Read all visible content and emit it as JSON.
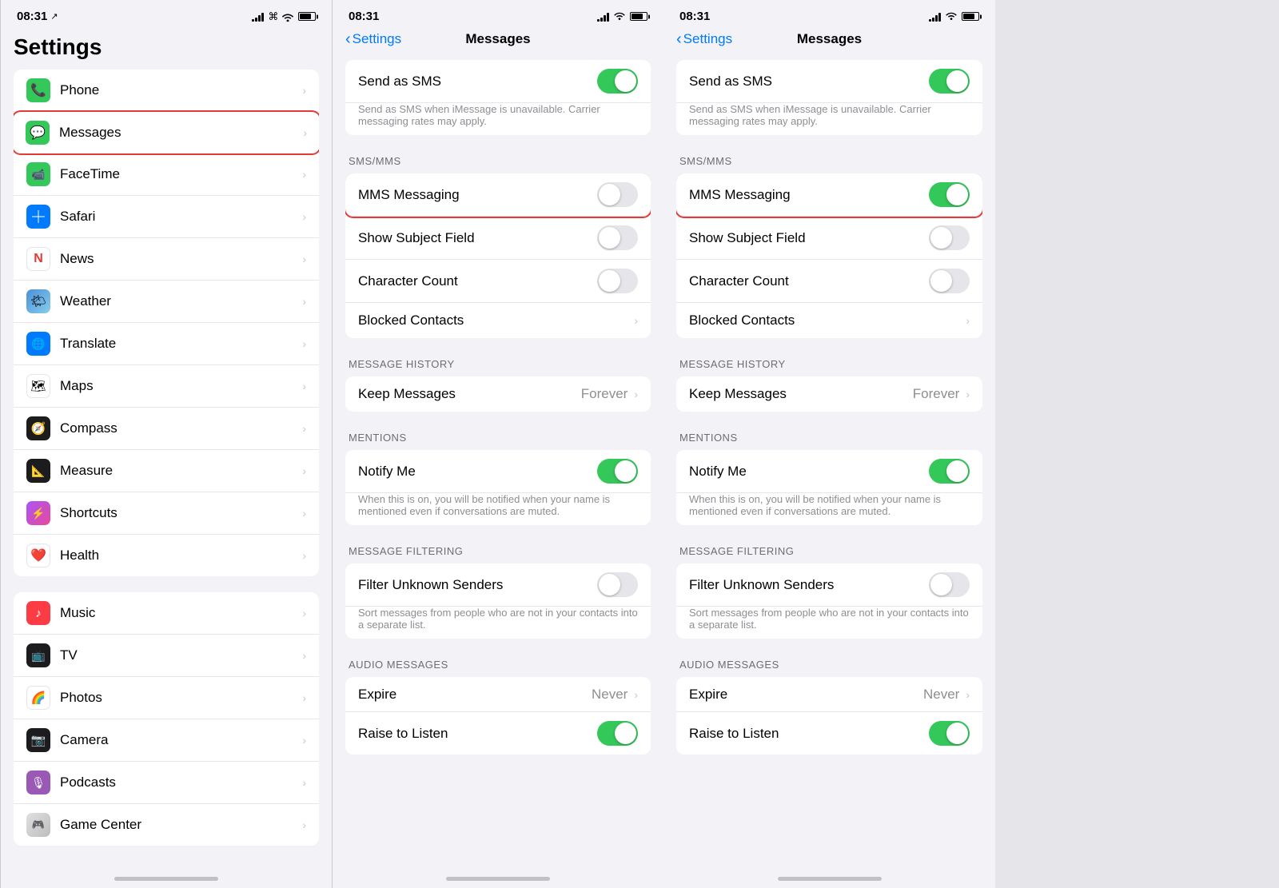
{
  "phone1": {
    "statusBar": {
      "time": "08:31",
      "location": true
    },
    "title": "Settings",
    "items_top": [
      {
        "id": "phone",
        "label": "Phone",
        "icon": "📞",
        "iconClass": "icon-phone",
        "chevron": true,
        "highlighted": false
      },
      {
        "id": "messages",
        "label": "Messages",
        "icon": "💬",
        "iconClass": "icon-messages",
        "chevron": true,
        "highlighted": true
      },
      {
        "id": "facetime",
        "label": "FaceTime",
        "icon": "📹",
        "iconClass": "icon-facetime",
        "chevron": true
      },
      {
        "id": "safari",
        "label": "Safari",
        "icon": "🧭",
        "iconClass": "icon-safari",
        "chevron": true
      },
      {
        "id": "news",
        "label": "News",
        "icon": "📰",
        "iconClass": "icon-news",
        "chevron": true
      },
      {
        "id": "weather",
        "label": "Weather",
        "icon": "🌤",
        "iconClass": "icon-weather",
        "chevron": true
      },
      {
        "id": "translate",
        "label": "Translate",
        "icon": "🌐",
        "iconClass": "icon-translate",
        "chevron": true
      },
      {
        "id": "maps",
        "label": "Maps",
        "icon": "🗺",
        "iconClass": "icon-maps",
        "chevron": true
      },
      {
        "id": "compass",
        "label": "Compass",
        "icon": "🧭",
        "iconClass": "icon-compass",
        "chevron": true
      },
      {
        "id": "measure",
        "label": "Measure",
        "icon": "📐",
        "iconClass": "icon-measure",
        "chevron": true
      },
      {
        "id": "shortcuts",
        "label": "Shortcuts",
        "icon": "⚡",
        "iconClass": "icon-shortcuts",
        "chevron": true
      },
      {
        "id": "health",
        "label": "Health",
        "icon": "❤️",
        "iconClass": "icon-health",
        "chevron": true
      }
    ],
    "items_bottom": [
      {
        "id": "music",
        "label": "Music",
        "icon": "🎵",
        "iconClass": "icon-music",
        "chevron": true
      },
      {
        "id": "tv",
        "label": "TV",
        "icon": "📺",
        "iconClass": "icon-tv",
        "chevron": true
      },
      {
        "id": "photos",
        "label": "Photos",
        "icon": "🖼",
        "iconClass": "icon-photos",
        "chevron": true
      },
      {
        "id": "camera",
        "label": "Camera",
        "icon": "📷",
        "iconClass": "icon-camera",
        "chevron": true
      },
      {
        "id": "podcasts",
        "label": "Podcasts",
        "icon": "🎙",
        "iconClass": "icon-podcasts",
        "chevron": true
      },
      {
        "id": "gamecenter",
        "label": "Game Center",
        "icon": "🎮",
        "iconClass": "icon-gamecenter",
        "chevron": true
      }
    ]
  },
  "phone2": {
    "statusBar": {
      "time": "08:31"
    },
    "backLabel": "Settings",
    "title": "Messages",
    "sections": [
      {
        "id": "imessage-section",
        "label": "",
        "rows": [
          {
            "id": "send-as-sms",
            "label": "Send as SMS",
            "type": "toggle",
            "toggleOn": true
          },
          {
            "id": "send-as-sms-sub",
            "type": "subtext",
            "text": "Send as SMS when iMessage is unavailable. Carrier messaging rates may apply."
          }
        ]
      },
      {
        "id": "sms-mms",
        "label": "SMS/MMS",
        "rows": [
          {
            "id": "mms-messaging",
            "label": "MMS Messaging",
            "type": "toggle",
            "toggleOn": false,
            "highlighted": true
          },
          {
            "id": "show-subject",
            "label": "Show Subject Field",
            "type": "toggle",
            "toggleOn": false
          },
          {
            "id": "char-count",
            "label": "Character Count",
            "type": "toggle",
            "toggleOn": false
          },
          {
            "id": "blocked-contacts",
            "label": "Blocked Contacts",
            "type": "chevron"
          }
        ]
      },
      {
        "id": "msg-history",
        "label": "MESSAGE HISTORY",
        "rows": [
          {
            "id": "keep-messages",
            "label": "Keep Messages",
            "type": "value-chevron",
            "value": "Forever"
          }
        ]
      },
      {
        "id": "mentions",
        "label": "MENTIONS",
        "rows": [
          {
            "id": "notify-me",
            "label": "Notify Me",
            "type": "toggle",
            "toggleOn": true
          },
          {
            "id": "notify-me-sub",
            "type": "subtext",
            "text": "When this is on, you will be notified when your name is mentioned even if conversations are muted."
          }
        ]
      },
      {
        "id": "msg-filtering",
        "label": "MESSAGE FILTERING",
        "rows": [
          {
            "id": "filter-unknown",
            "label": "Filter Unknown Senders",
            "type": "toggle",
            "toggleOn": false
          },
          {
            "id": "filter-sub",
            "type": "subtext",
            "text": "Sort messages from people who are not in your contacts into a separate list."
          }
        ]
      },
      {
        "id": "audio-messages",
        "label": "AUDIO MESSAGES",
        "rows": [
          {
            "id": "expire",
            "label": "Expire",
            "type": "value-chevron",
            "value": "Never"
          },
          {
            "id": "raise-to-listen",
            "label": "Raise to Listen",
            "type": "toggle",
            "toggleOn": true
          }
        ]
      }
    ]
  },
  "phone3": {
    "statusBar": {
      "time": "08:31"
    },
    "backLabel": "Settings",
    "title": "Messages",
    "sections": [
      {
        "id": "imessage-section",
        "label": "",
        "rows": [
          {
            "id": "send-as-sms",
            "label": "Send as SMS",
            "type": "toggle",
            "toggleOn": true
          },
          {
            "id": "send-as-sms-sub",
            "type": "subtext",
            "text": "Send as SMS when iMessage is unavailable. Carrier messaging rates may apply."
          }
        ]
      },
      {
        "id": "sms-mms",
        "label": "SMS/MMS",
        "rows": [
          {
            "id": "mms-messaging",
            "label": "MMS Messaging",
            "type": "toggle",
            "toggleOn": true,
            "highlighted": true
          },
          {
            "id": "show-subject",
            "label": "Show Subject Field",
            "type": "toggle",
            "toggleOn": false
          },
          {
            "id": "char-count",
            "label": "Character Count",
            "type": "toggle",
            "toggleOn": false
          },
          {
            "id": "blocked-contacts",
            "label": "Blocked Contacts",
            "type": "chevron"
          }
        ]
      },
      {
        "id": "msg-history",
        "label": "MESSAGE HISTORY",
        "rows": [
          {
            "id": "keep-messages",
            "label": "Keep Messages",
            "type": "value-chevron",
            "value": "Forever"
          }
        ]
      },
      {
        "id": "mentions",
        "label": "MENTIONS",
        "rows": [
          {
            "id": "notify-me",
            "label": "Notify Me",
            "type": "toggle",
            "toggleOn": true
          },
          {
            "id": "notify-me-sub",
            "type": "subtext",
            "text": "When this is on, you will be notified when your name is mentioned even if conversations are muted."
          }
        ]
      },
      {
        "id": "msg-filtering",
        "label": "MESSAGE FILTERING",
        "rows": [
          {
            "id": "filter-unknown",
            "label": "Filter Unknown Senders",
            "type": "toggle",
            "toggleOn": false
          },
          {
            "id": "filter-sub",
            "type": "subtext",
            "text": "Sort messages from people who are not in your contacts into a separate list."
          }
        ]
      },
      {
        "id": "audio-messages",
        "label": "AUDIO MESSAGES",
        "rows": [
          {
            "id": "expire",
            "label": "Expire",
            "type": "value-chevron",
            "value": "Never"
          },
          {
            "id": "raise-to-listen",
            "label": "Raise to Listen",
            "type": "toggle",
            "toggleOn": true
          }
        ]
      }
    ]
  },
  "icons": {
    "chevron": "›",
    "back": "‹",
    "location": "⬆"
  }
}
